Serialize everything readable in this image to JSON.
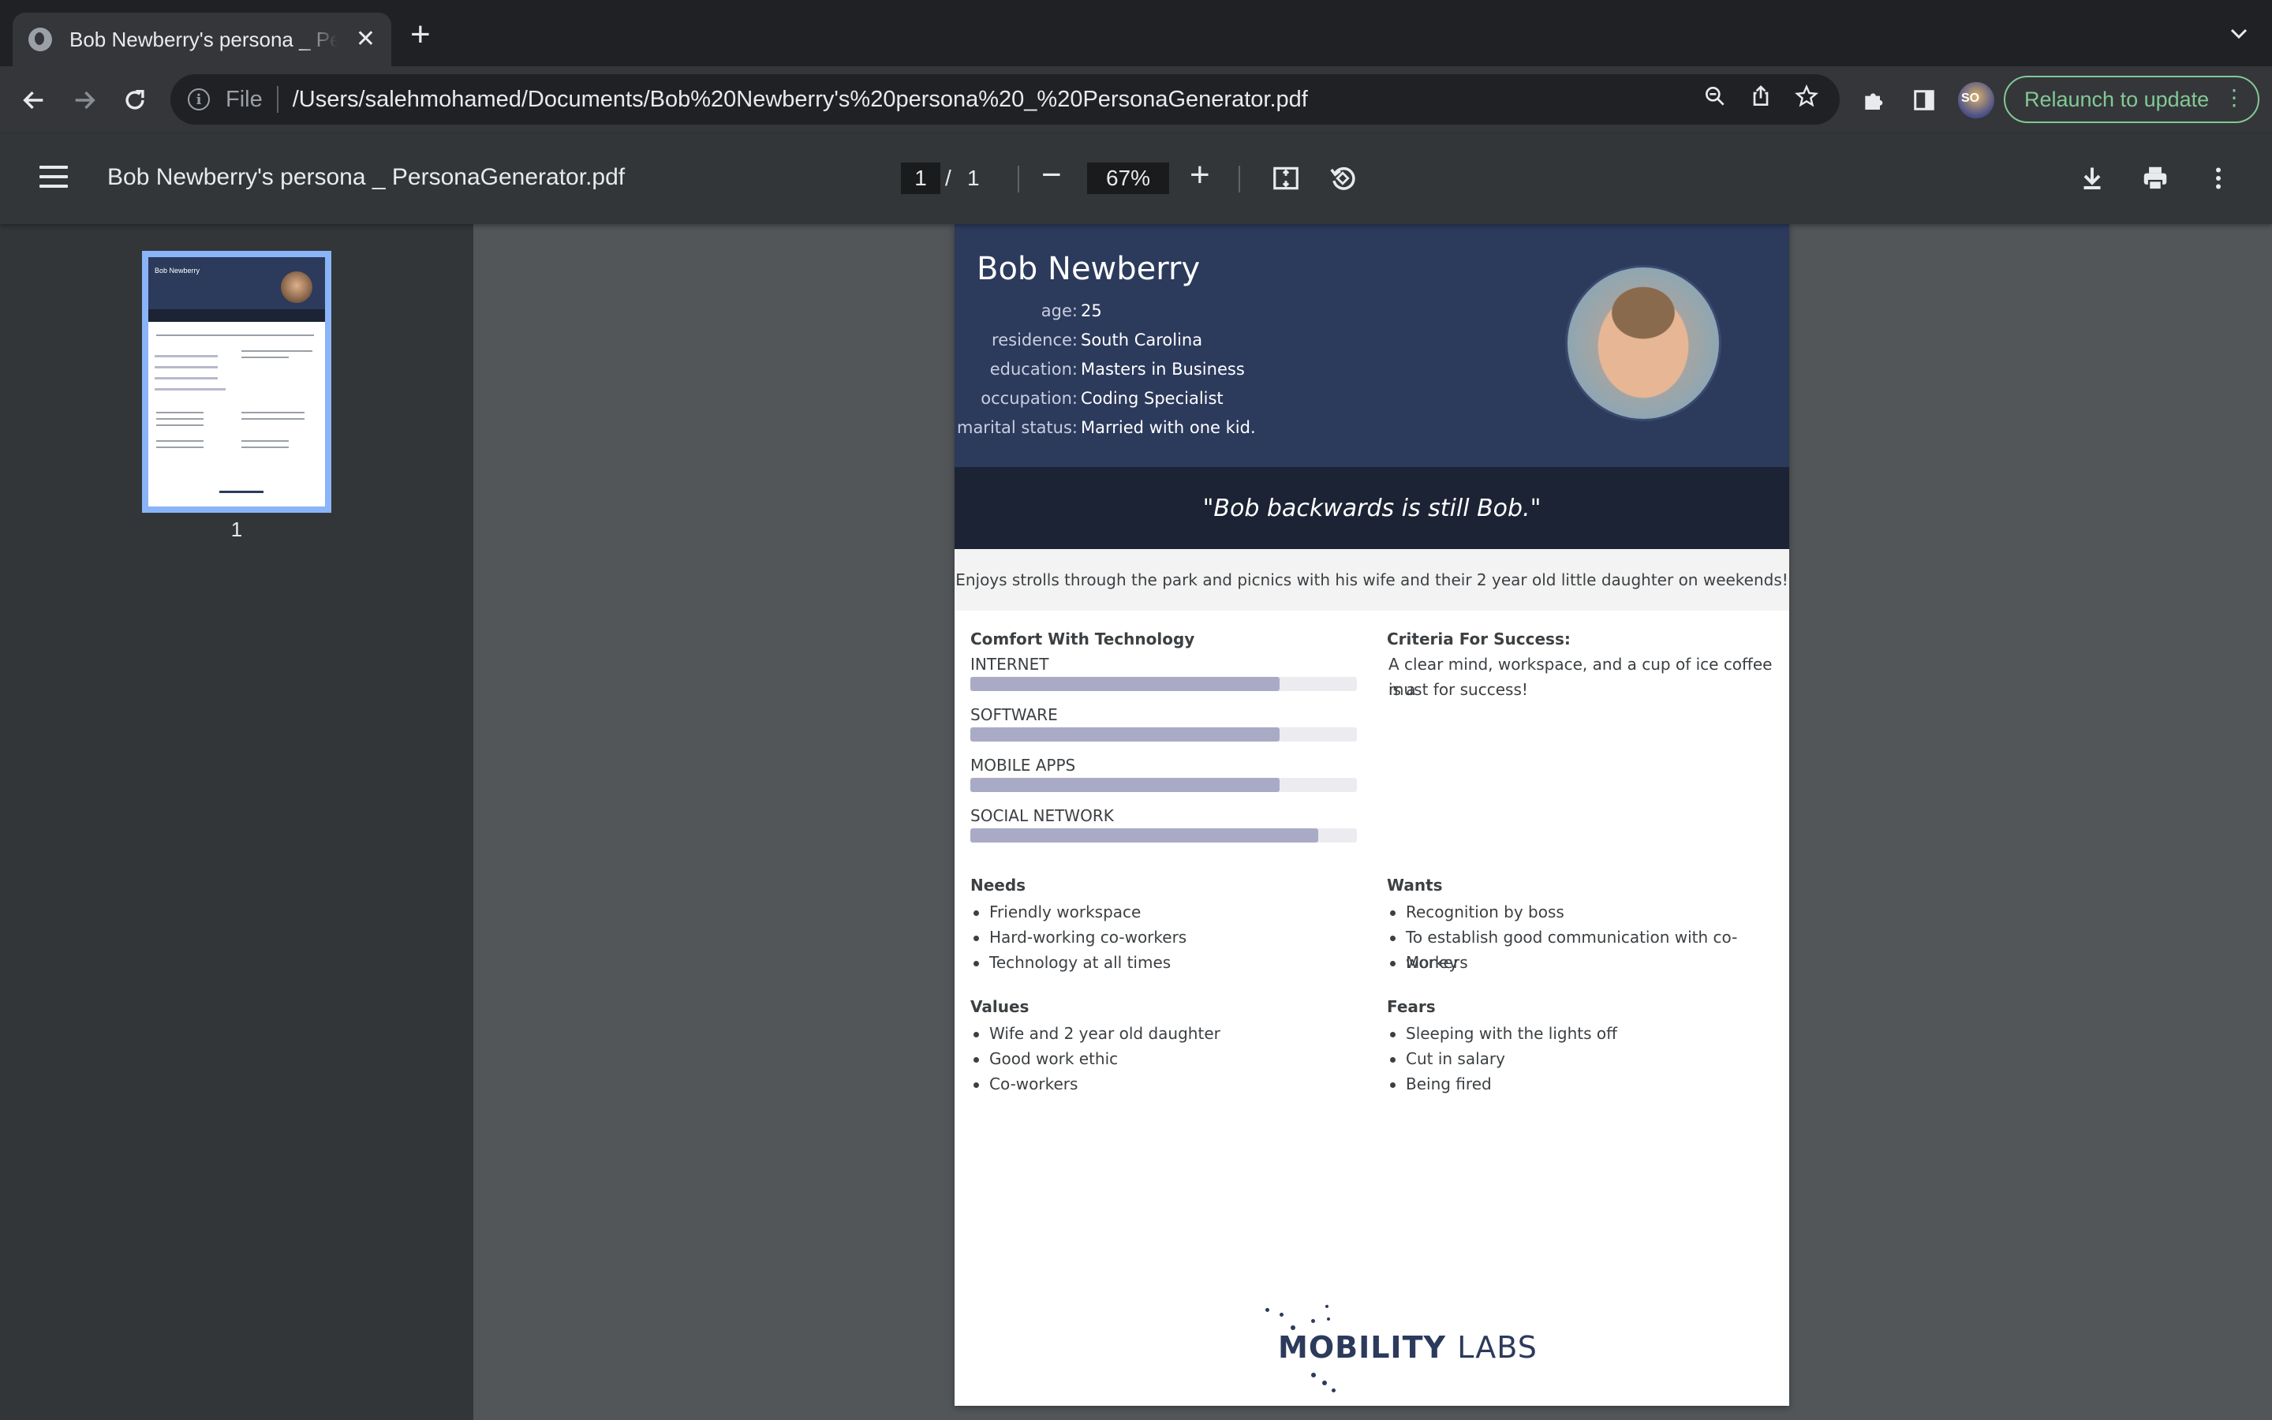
{
  "browser": {
    "tab_title": "Bob Newberry's persona _ PersonaGenerator.pdf",
    "tab_icon": "globe-icon",
    "address_scheme": "File",
    "address_url": "/Users/salehmohamed/Documents/Bob%20Newberry's%20persona%20_%20PersonaGenerator.pdf",
    "relaunch_label": "Relaunch to update",
    "profile_badge": "SO"
  },
  "viewer": {
    "doc_title": "Bob Newberry's persona _ PersonaGenerator.pdf",
    "current_page": "1",
    "page_separator": "/",
    "total_pages": "1",
    "zoom": "67%",
    "thumbnail_label": "1"
  },
  "persona": {
    "name": "Bob Newberry",
    "facts": [
      {
        "label": "age:",
        "value": "25"
      },
      {
        "label": "residence:",
        "value": "South Carolina"
      },
      {
        "label": "education:",
        "value": "Masters in Business"
      },
      {
        "label": "occupation:",
        "value": "Coding Specialist"
      },
      {
        "label": "marital status:",
        "value": "Married with one kid."
      }
    ],
    "quote": "\"Bob backwards is still Bob.\"",
    "bio": "Enjoys strolls through the park and picnics with his wife and their 2 year old little daughter on weekends!",
    "tech_heading": "Comfort With Technology",
    "skills": [
      {
        "label": "INTERNET",
        "level": 0.8
      },
      {
        "label": "SOFTWARE",
        "level": 0.8
      },
      {
        "label": "MOBILE APPS",
        "level": 0.8
      },
      {
        "label": "SOCIAL NETWORK",
        "level": 0.9
      }
    ],
    "criteria_heading": "Criteria For Success:",
    "criteria_text_line1": "A clear mind, workspace, and a cup of ice coffee is a",
    "criteria_text_line2": "must for success!",
    "needs_heading": "Needs",
    "needs": [
      "Friendly workspace",
      "Hard-working co-workers",
      "Technology at all times"
    ],
    "wants_heading": "Wants",
    "wants": [
      "Recognition by boss",
      "To establish good communication with co-workers",
      "Money"
    ],
    "values_heading": "Values",
    "values": [
      "Wife and 2 year old daughter",
      "Good work ethic",
      "Co-workers"
    ],
    "fears_heading": "Fears",
    "fears": [
      "Sleeping with the lights off",
      "Cut in salary",
      "Being fired"
    ],
    "logo_bold": "MOBILITY",
    "logo_light": "LABS"
  },
  "colors": {
    "header": "#2c3a5c",
    "quote_band": "#1b2334",
    "skill_fill": "#a9abc6",
    "relaunch_accent": "#81c995",
    "thumb_highlight": "#8ab4f8"
  }
}
